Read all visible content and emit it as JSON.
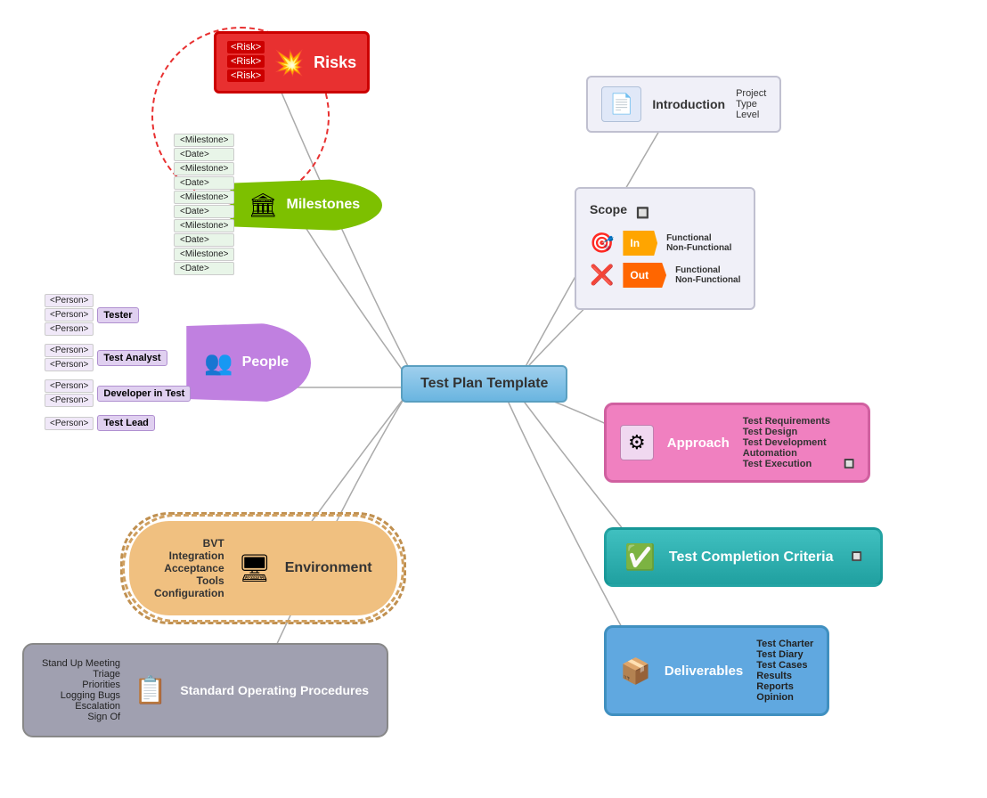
{
  "title": "Test Plan Template",
  "center": {
    "label": "Test Plan Template"
  },
  "risks": {
    "label": "Risks",
    "icon": "💥",
    "items": [
      "<Risk>",
      "<Risk>",
      "<Risk>"
    ]
  },
  "milestones": {
    "label": "Milestones",
    "icon": "🏛",
    "items": [
      "<Milestone>",
      "<Date>",
      "<Milestone>",
      "<Date>",
      "<Milestone>",
      "<Date>",
      "<Milestone>",
      "<Date>",
      "<Milestone>",
      "<Date>"
    ]
  },
  "people": {
    "label": "People",
    "icon": "👥",
    "roles": {
      "tester": {
        "label": "Tester",
        "persons": [
          "<Person>",
          "<Person>",
          "<Person>"
        ]
      },
      "analyst": {
        "label": "Test Analyst",
        "persons": [
          "<Person>",
          "<Person>"
        ]
      },
      "developer": {
        "label": "Developer in Test",
        "persons": [
          "<Person>",
          "<Person>"
        ]
      },
      "lead": {
        "label": "Test Lead",
        "persons": [
          "<Person>"
        ]
      }
    }
  },
  "environment": {
    "label": "Environment",
    "icon": "🖥",
    "items": [
      "BVT",
      "Integration",
      "Acceptance",
      "Tools",
      "Configuration"
    ]
  },
  "sop": {
    "label": "Standard Operating Procedures",
    "icon": "📋",
    "items": [
      "Stand Up Meeting",
      "Triage",
      "Priorities",
      "Logging Bugs",
      "Escalation",
      "Sign Of"
    ]
  },
  "introduction": {
    "label": "Introduction",
    "icon": "📄",
    "items": [
      "Project",
      "Type",
      "Level"
    ]
  },
  "scope": {
    "label": "Scope",
    "in": {
      "label": "In",
      "icon": "🎯",
      "items": [
        "Functional",
        "Non-Functional"
      ]
    },
    "out": {
      "label": "Out",
      "icon": "❌",
      "items": [
        "Functional",
        "Non-Functional"
      ]
    }
  },
  "approach": {
    "label": "Approach",
    "icon": "⚙",
    "items": [
      "Test Requirements",
      "Test Design",
      "Test Development",
      "Automation",
      "Test Execution"
    ]
  },
  "tcc": {
    "label": "Test Completion Criteria",
    "icon": "✅"
  },
  "deliverables": {
    "label": "Deliverables",
    "icon": "📦",
    "items": [
      "Test Charter",
      "Test Diary",
      "Test Cases",
      "Results",
      "Reports",
      "Opinion"
    ]
  }
}
